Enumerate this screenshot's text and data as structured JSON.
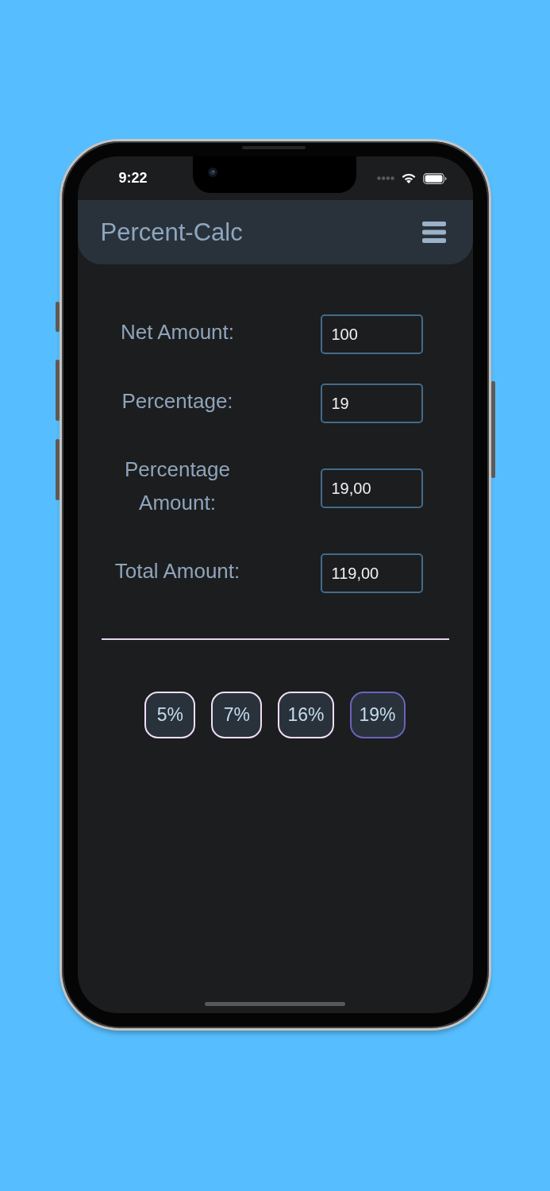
{
  "status_bar": {
    "time": "9:22"
  },
  "header": {
    "title": "Percent-Calc"
  },
  "fields": [
    {
      "label": "Net Amount:",
      "value": "100"
    },
    {
      "label": "Percentage:",
      "value": "19"
    },
    {
      "label": "Percentage Amount:",
      "value": "19,00"
    },
    {
      "label": "Total Amount:",
      "value": "119,00"
    }
  ],
  "presets": [
    {
      "label": "5%",
      "selected": false
    },
    {
      "label": "7%",
      "selected": false
    },
    {
      "label": "16%",
      "selected": false
    },
    {
      "label": "19%",
      "selected": true
    }
  ]
}
